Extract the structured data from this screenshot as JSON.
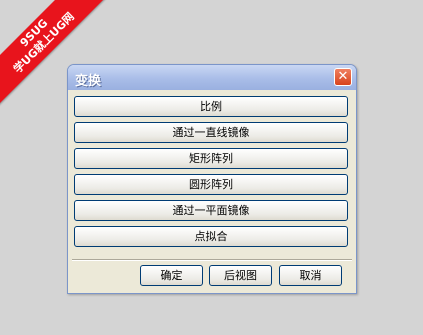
{
  "watermark": {
    "line1": "9SUG",
    "line2": "学UG就上UG网"
  },
  "dialog": {
    "title": "变换",
    "close_label": "✕",
    "options": [
      "比例",
      "通过一直线镜像",
      "矩形阵列",
      "圆形阵列",
      "通过一平面镜像",
      "点拟合"
    ],
    "buttons": {
      "ok": "确定",
      "back": "后视图",
      "cancel": "取消"
    }
  }
}
